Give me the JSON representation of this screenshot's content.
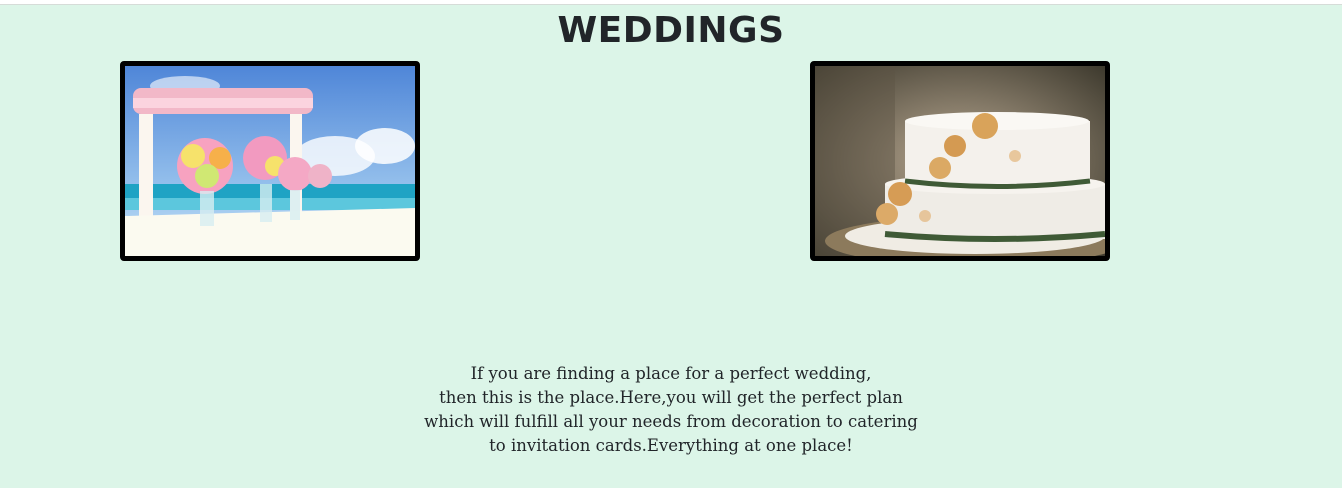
{
  "page": {
    "title": "WEDDINGS",
    "background_color": "#dcf5e8"
  },
  "gallery": {
    "images": [
      {
        "icon": "beach-wedding-table-image"
      },
      {
        "icon": "wedding-cake-image"
      }
    ]
  },
  "description": {
    "lines": [
      "If you are finding a place for a perfect wedding,",
      "then this is the place.Here,you will get the perfect plan",
      "which will fulfill all your needs from decoration to catering",
      "to invitation cards.Everything at one place!"
    ]
  }
}
